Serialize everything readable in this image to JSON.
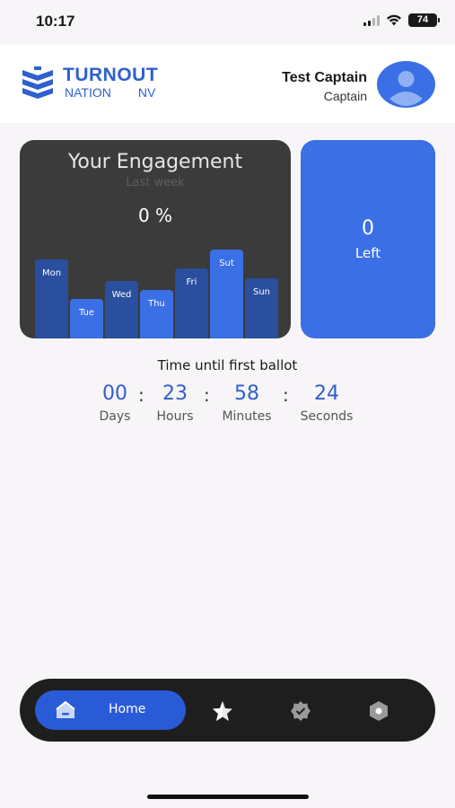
{
  "status_bar": {
    "time": "10:17",
    "battery": "74"
  },
  "header": {
    "logo_title": "TURNOUT",
    "logo_sub_left": "NATION",
    "logo_sub_right": "NV",
    "user_name": "Test Captain",
    "user_role": "Captain",
    "avatar_icon": "user-avatar-icon"
  },
  "engagement": {
    "title": "Your Engagement",
    "subtitle": "Last week",
    "percent": "0 %",
    "chart_data": {
      "type": "bar",
      "categories": [
        "Mon",
        "Tue",
        "Wed",
        "Thu",
        "Fri",
        "Sut",
        "Sun"
      ],
      "values": [
        88,
        44,
        64,
        54,
        78,
        99,
        67
      ],
      "ylim": [
        0,
        100
      ],
      "colors": [
        "#2a4f9e",
        "#3a6fe6",
        "#2a4f9e",
        "#3a6fe6",
        "#2a4f9e",
        "#3a6fe6",
        "#2a4f9e"
      ]
    }
  },
  "left_card": {
    "count": "0",
    "label": "Left"
  },
  "countdown": {
    "title": "Time until first ballot",
    "days": "00",
    "days_label": "Days",
    "hours": "23",
    "hours_label": "Hours",
    "minutes": "58",
    "minutes_label": "Minutes",
    "seconds": "24",
    "seconds_label": "Seconds",
    "separator": ":"
  },
  "nav": {
    "home_label": "Home",
    "home_icon": "home-icon",
    "icons": [
      "star-icon",
      "badge-check-icon",
      "hexagon-settings-icon"
    ]
  },
  "colors": {
    "accent": "#3a6fe6",
    "dark_card": "#3b3b3b",
    "nav_bg": "#1e1e1e"
  }
}
